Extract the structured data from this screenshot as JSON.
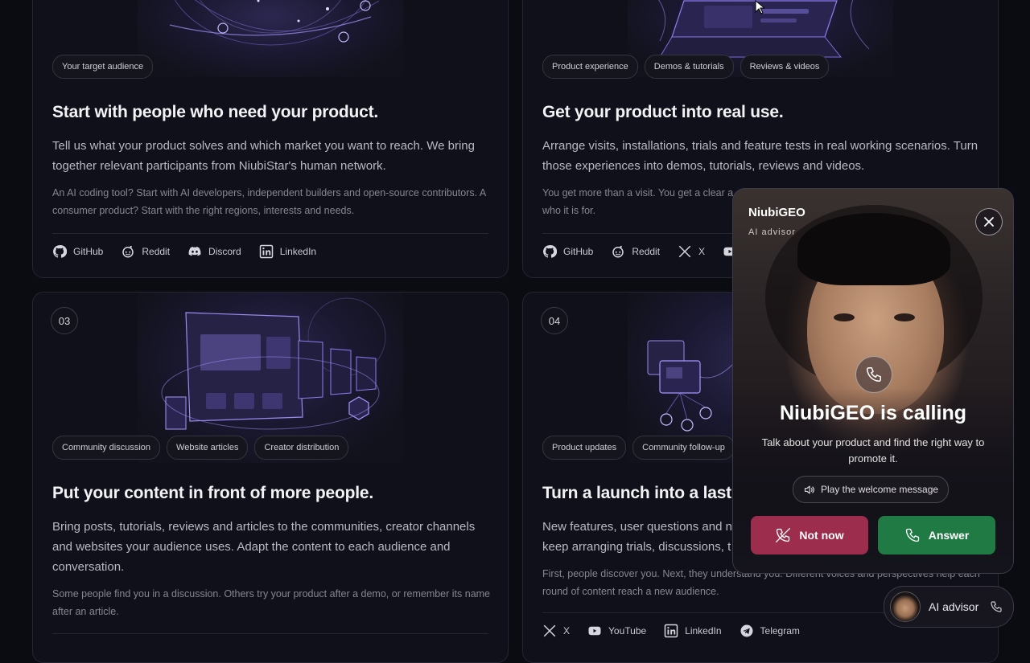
{
  "cards": [
    {
      "chips": [
        "Your target audience"
      ],
      "title": "Start with people who need your product.",
      "desc": "Tell us what your product solves and which market you want to reach. We bring together relevant participants from NiubiStar's human network.",
      "note": "An AI coding tool? Start with AI developers, independent builders and open-source contributors. A consumer product? Start with the right regions, interests and needs.",
      "socials": [
        "GitHub",
        "Reddit",
        "Discord",
        "LinkedIn"
      ]
    },
    {
      "chips": [
        "Product experience",
        "Demos & tutorials",
        "Reviews & videos"
      ],
      "title": "Get your product into real use.",
      "desc": "Arrange visits, installations, trials and feature tests in real working scenarios. Turn those experiences into demos, tutorials, reviews and videos.",
      "note": "You get more than a visit. You get a clear a",
      "note2": "who it is for.",
      "socials": [
        "GitHub",
        "Reddit",
        "X",
        "Y"
      ]
    },
    {
      "number": "03",
      "chips": [
        "Community discussion",
        "Website articles",
        "Creator distribution"
      ],
      "title": "Put your content in front of more people.",
      "desc": "Bring posts, tutorials, reviews and articles to the communities, creator channels and websites your audience uses. Adapt the content to each audience and conversation.",
      "note": "Some people find you in a discussion. Others try your product after a demo, or remember its name after an article."
    },
    {
      "number": "04",
      "chips": [
        "Product updates",
        "Community follow-up"
      ],
      "title": "Turn a launch into a lastin",
      "desc1": "New features, user questions and ne",
      "desc2": "keep arranging trials, discussions, t",
      "note": "First, people discover you. Next, they understand you. Different voices and perspectives help each round of content reach a new audience.",
      "socials": [
        "X",
        "YouTube",
        "LinkedIn",
        "Telegram"
      ]
    }
  ],
  "call": {
    "brand": "NiubiGEO",
    "subtitle": "AI advisor",
    "heading": "NiubiGEO is calling",
    "text": "Talk about your product and find the right way to promote it.",
    "play_label": "Play the welcome message",
    "decline_label": "Not now",
    "answer_label": "Answer"
  },
  "advisor": {
    "label": "AI advisor"
  },
  "colors": {
    "decline": "#9c2d4c",
    "answer": "#1f7a44",
    "background": "#0b0b12"
  }
}
